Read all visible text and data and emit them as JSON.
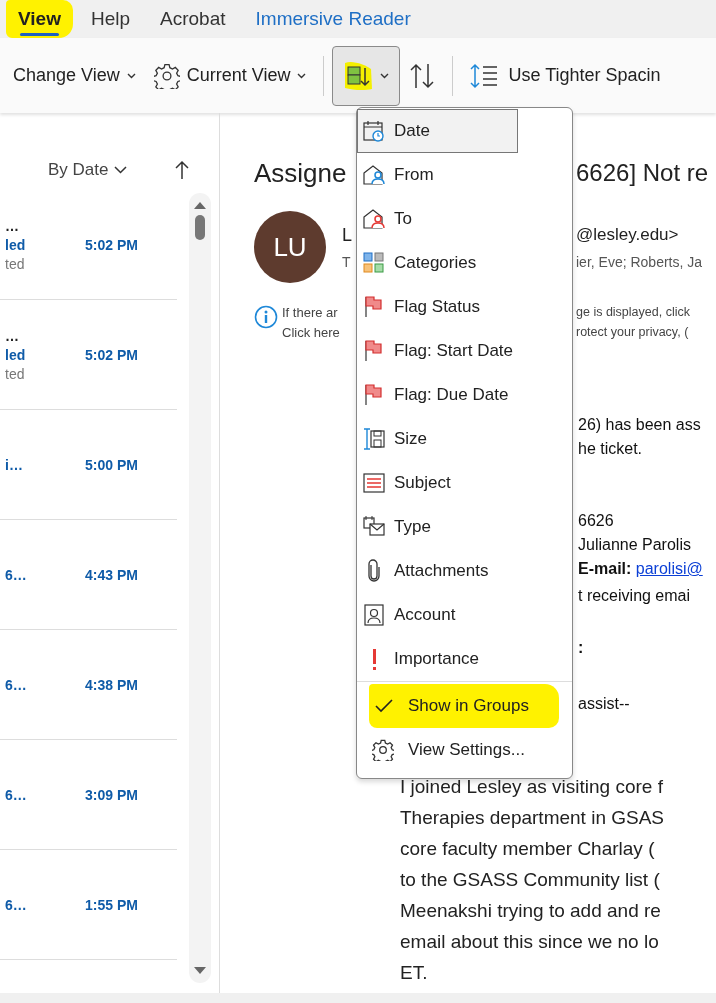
{
  "tabs": [
    {
      "label": "View",
      "selected": true,
      "accent": false
    },
    {
      "label": "Help",
      "selected": false,
      "accent": false
    },
    {
      "label": "Acrobat",
      "selected": false,
      "accent": false
    },
    {
      "label": "Immersive Reader",
      "selected": false,
      "accent": true
    }
  ],
  "ribbon": {
    "change_view": "Change View",
    "current_view": "Current View",
    "arrange_menu_open": true,
    "tighter_spacing": "Use Tighter Spacin"
  },
  "message_list": {
    "arrange_by": "By Date",
    "rows": [
      {
        "sender": "…",
        "subject": "led",
        "preview": "ted",
        "time": "5:02 PM"
      },
      {
        "sender": "…",
        "subject": "led",
        "preview": "ted",
        "time": "5:02 PM"
      },
      {
        "subject": "i…",
        "time": "5:00 PM"
      },
      {
        "subject": "6…",
        "time": "4:43 PM"
      },
      {
        "subject": "6…",
        "time": "4:38 PM"
      },
      {
        "subject": "6…",
        "time": "3:09 PM"
      },
      {
        "subject": "6…",
        "time": "1:55 PM"
      }
    ]
  },
  "reading_pane": {
    "title_left": "Assigne",
    "title_right": "6626] Not re",
    "initials": "LU",
    "sender_left": "L",
    "sender_right": "@lesley.edu>",
    "to_left": "T",
    "to_right": "ier, Eve; Roberts, Ja",
    "notice": [
      {
        "left": "If there ar",
        "right": "ge is displayed, click"
      },
      {
        "left": "Click here",
        "right": "rotect your privacy, ("
      }
    ],
    "ticket_lines": [
      {
        "kind": "text",
        "text": "26) has been ass"
      },
      {
        "kind": "text",
        "text": "he ticket."
      },
      {
        "kind": "text",
        "text": "6626"
      },
      {
        "kind": "text",
        "text": "Julianne Parolis"
      },
      {
        "kind": "field",
        "label": "E-mail:",
        "link": "parolisi@"
      },
      {
        "kind": "text",
        "text": "t receiving emai"
      },
      {
        "kind": "heading",
        "text": ":"
      },
      {
        "kind": "text",
        "text": "assist--"
      }
    ],
    "paragraph": [
      "I joined Lesley as visiting core f",
      "Therapies department in GSAS",
      "core faculty member Charlay (",
      "to the GSASS Community list (",
      "Meenakshi trying to add and re",
      "email about this since we no lo",
      "ET."
    ]
  },
  "arrange_menu": {
    "items": [
      {
        "label": "Date",
        "kind": "date",
        "selected": true
      },
      {
        "label": "From",
        "kind": "from",
        "selected": false
      },
      {
        "label": "To",
        "kind": "to",
        "selected": false
      },
      {
        "label": "Categories",
        "kind": "categories",
        "selected": false
      },
      {
        "label": "Flag Status",
        "kind": "flag",
        "selected": false
      },
      {
        "label": "Flag: Start Date",
        "kind": "flag",
        "selected": false
      },
      {
        "label": "Flag: Due Date",
        "kind": "flag",
        "selected": false
      },
      {
        "label": "Size",
        "kind": "size",
        "selected": false
      },
      {
        "label": "Subject",
        "kind": "subject",
        "selected": false
      },
      {
        "label": "Type",
        "kind": "type",
        "selected": false
      },
      {
        "label": "Attachments",
        "kind": "attachment",
        "selected": false
      },
      {
        "label": "Account",
        "kind": "account",
        "selected": false
      },
      {
        "label": "Importance",
        "kind": "importance",
        "selected": false
      }
    ],
    "show_in_groups": {
      "label": "Show in Groups",
      "checked": true
    },
    "view_settings": "View Settings..."
  }
}
